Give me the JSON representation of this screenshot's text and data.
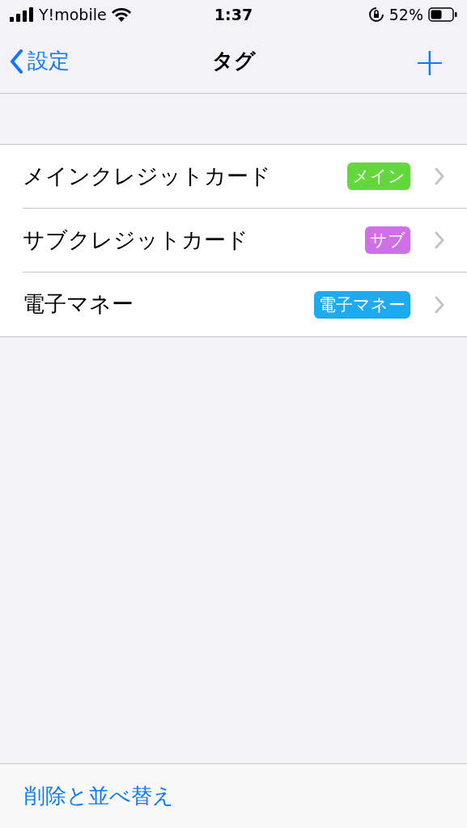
{
  "status_bar": {
    "carrier": "Y!mobile",
    "time": "1:37",
    "battery": "52%"
  },
  "nav": {
    "back": "設定",
    "title": "タグ",
    "add": "+"
  },
  "tags": [
    {
      "name": "メインクレジットカード",
      "tag": "メイン",
      "color": "#62d83a"
    },
    {
      "name": "サブクレジットカード",
      "tag": "サブ",
      "color": "#d070e6"
    },
    {
      "name": "電子マネー",
      "tag": "電子マネー",
      "color": "#1eaaf1"
    }
  ],
  "toolbar": {
    "action": "削除と並べ替え"
  }
}
